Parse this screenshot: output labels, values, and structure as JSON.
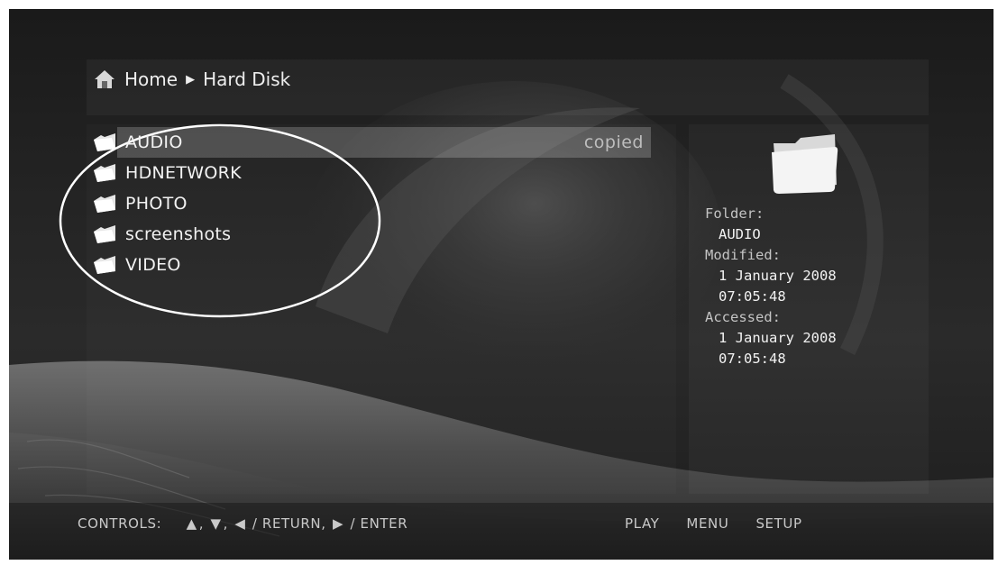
{
  "breadcrumb": {
    "items": [
      {
        "label": "Home"
      },
      {
        "label": "Hard Disk"
      }
    ],
    "separator_icon": "triangle-right-icon"
  },
  "file_list": {
    "items": [
      {
        "name": "AUDIO",
        "status": "copied",
        "selected": true,
        "icon": "folder-icon"
      },
      {
        "name": "HDNETWORK",
        "status": "",
        "selected": false,
        "icon": "folder-icon"
      },
      {
        "name": "PHOTO",
        "status": "",
        "selected": false,
        "icon": "folder-icon"
      },
      {
        "name": "screenshots",
        "status": "",
        "selected": false,
        "icon": "folder-icon"
      },
      {
        "name": "VIDEO",
        "status": "",
        "selected": false,
        "icon": "folder-icon"
      }
    ]
  },
  "info_panel": {
    "icon": "folder-icon",
    "folder_label": "Folder:",
    "folder_value": "AUDIO",
    "modified_label": "Modified:",
    "modified_date": "1 January 2008",
    "modified_time": "07:05:48",
    "accessed_label": "Accessed:",
    "accessed_date": "1 January 2008",
    "accessed_time": "07:05:48"
  },
  "footer": {
    "controls_label": "CONTROLS:",
    "up_icon": "triangle-up-icon",
    "down_icon": "triangle-down-icon",
    "left_icon": "triangle-left-icon",
    "right_icon": "triangle-right-icon",
    "comma": ",",
    "return_label": "/ RETURN,",
    "enter_label": "/ ENTER",
    "play_label": "PLAY",
    "menu_label": "MENU",
    "setup_label": "SETUP"
  },
  "colors": {
    "background": "#222222",
    "text": "#f2f2f2",
    "highlight": "#5a5a5a",
    "muted_text": "#bdbdbd"
  }
}
